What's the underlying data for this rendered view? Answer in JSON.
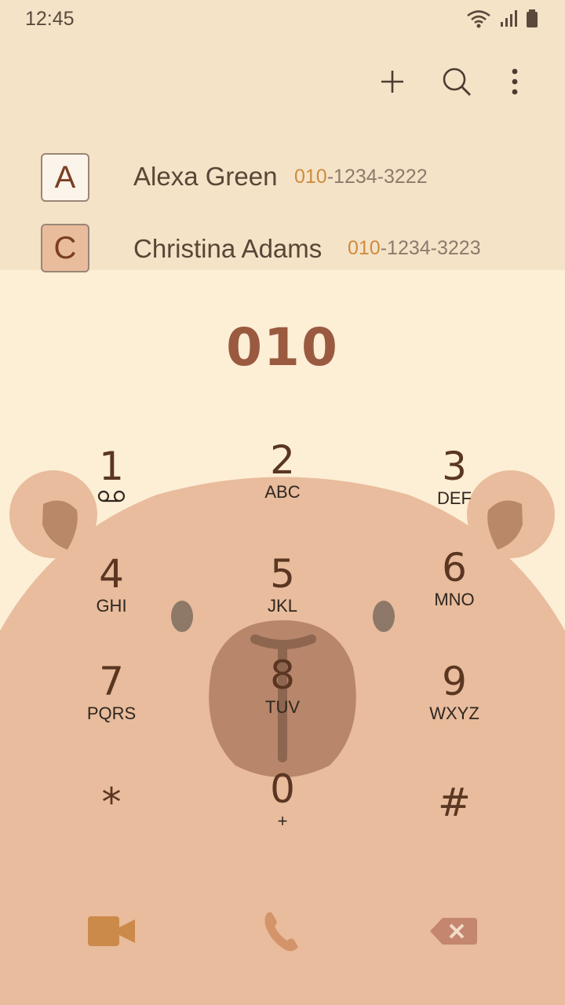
{
  "status": {
    "time": "12:45"
  },
  "toolbar": {
    "add": "plus-icon",
    "search": "search-icon",
    "more": "more-vert-icon"
  },
  "contacts": [
    {
      "initial": "A",
      "name": "Alexa Green",
      "match": "010",
      "rest": "-1234-3222"
    },
    {
      "initial": "C",
      "name": "Christina Adams",
      "match": "010",
      "rest": "-1234-3223"
    }
  ],
  "dialer": {
    "number": "010",
    "keys": [
      {
        "digit": "1",
        "letters": ""
      },
      {
        "digit": "2",
        "letters": "ABC"
      },
      {
        "digit": "3",
        "letters": "DEF"
      },
      {
        "digit": "4",
        "letters": "GHI"
      },
      {
        "digit": "5",
        "letters": "JKL"
      },
      {
        "digit": "6",
        "letters": "MNO"
      },
      {
        "digit": "7",
        "letters": "PQRS"
      },
      {
        "digit": "8",
        "letters": "TUV"
      },
      {
        "digit": "9",
        "letters": "WXYZ"
      },
      {
        "digit": "*",
        "letters": ""
      },
      {
        "digit": "0",
        "letters": "+"
      },
      {
        "digit": "#",
        "letters": ""
      }
    ]
  },
  "actions": {
    "video": "video-call-icon",
    "call": "phone-icon",
    "delete": "backspace-icon"
  },
  "colors": {
    "accent": "#d08b3e",
    "bear": "#e8bc9c",
    "call": "#d4946a"
  }
}
